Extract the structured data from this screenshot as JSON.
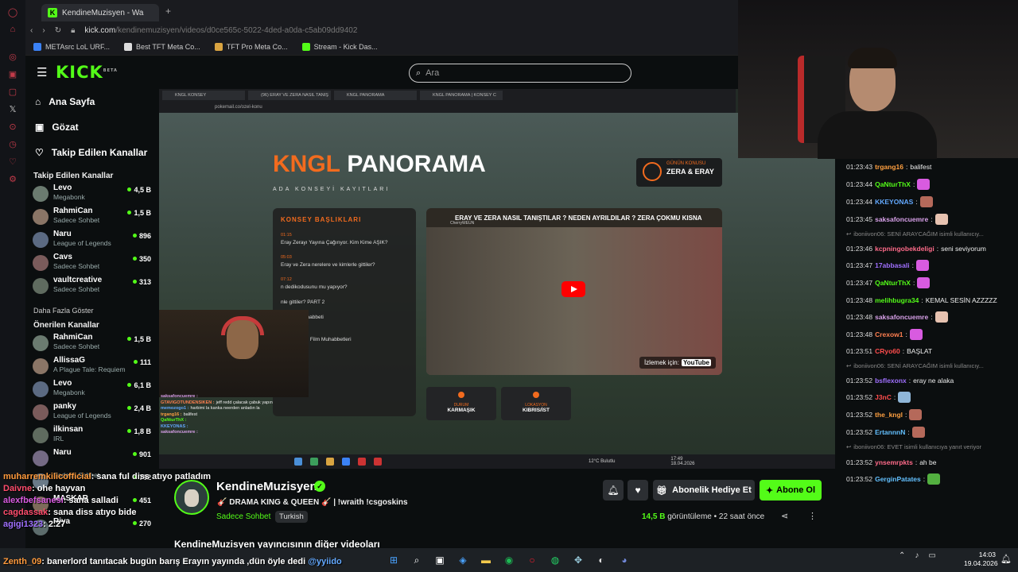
{
  "browser": {
    "tab_title": "KendineMuzisyen - Wa",
    "url_domain": "kick.com",
    "url_path": "/kendinemuzisyen/videos/d0ce565c-5022-4ded-a0da-c5ab09dd9402",
    "bookmarks": [
      "METAsrc LoL URF...",
      "Best TFT Meta Co...",
      "TFT Pro Meta Co...",
      "Stream - Kick Das..."
    ]
  },
  "header": {
    "logo": "KICK",
    "logo_sup": "BETA",
    "search_placeholder": "Ara"
  },
  "nav": {
    "home": "Ana Sayfa",
    "browse": "Gözat",
    "following": "Takip Edilen Kanallar"
  },
  "followed_title": "Takip Edilen Kanallar",
  "followed": [
    {
      "name": "Levo",
      "game": "Megabonk",
      "viewers": "4,5 B"
    },
    {
      "name": "RahmiCan",
      "game": "Sadece Sohbet",
      "viewers": "1,5 B"
    },
    {
      "name": "Naru",
      "game": "League of Legends",
      "viewers": "896"
    },
    {
      "name": "Cavs",
      "game": "Sadece Sohbet",
      "viewers": "350"
    },
    {
      "name": "vaultcreative",
      "game": "Sadece Sohbet",
      "viewers": "313"
    }
  ],
  "show_more": "Daha Fazla Göster",
  "recommended_title": "Önerilen Kanallar",
  "recommended": [
    {
      "name": "RahmiCan",
      "game": "Sadece Sohbet",
      "viewers": "1,5 B"
    },
    {
      "name": "AllissaG",
      "game": "A Plague Tale: Requiem",
      "viewers": "111"
    },
    {
      "name": "Levo",
      "game": "Megabonk",
      "viewers": "6,1 B"
    },
    {
      "name": "panky",
      "game": "League of Legends",
      "viewers": "2,4 B"
    },
    {
      "name": "ilkinsan",
      "game": "IRL",
      "viewers": "1,8 B"
    },
    {
      "name": "Naru",
      "game": "",
      "viewers": "901"
    },
    {
      "name": "",
      "game": "Sadece Sohbet",
      "viewers": "792"
    },
    {
      "name": "MASKAR",
      "game": "",
      "viewers": "451"
    },
    {
      "name": "Riya",
      "game": "",
      "viewers": "270"
    }
  ],
  "video": {
    "inner_tabs": [
      "KNGL KONSEY",
      "(96) ERAY VE ZERA NASIL TANIŞ",
      "KNGL PANORAMA",
      "KNGL PANORAMA | KONSEY C"
    ],
    "inner_url": "pokemail.co/ozel-konu",
    "title_a": "KNGL",
    "title_b": " PANORAMA",
    "subtitle": "ADA KONSEYİ KAYITLARI",
    "gunun_label": "GÜNÜN KONUSU",
    "gunun_value": "ZERA & ERAY",
    "panel_title": "KONSEY BAŞLIKLARI",
    "topics": [
      {
        "n": "01:15",
        "t": "Eray Zerayı Yayına Çağırıyor. Kim Kime AŞIK?"
      },
      {
        "n": "05:03",
        "t": "Eray ve Zera nerelere ve kimlerle gittiler?"
      },
      {
        "n": "07:12",
        "t": "n dedikodusunu mu yapıyor?"
      },
      {
        "n": "",
        "t": "nle gittiler? PART 2"
      },
      {
        "n": "",
        "t": "y Piano Muhabbeti"
      },
      {
        "n": "12:21",
        "t": "Eski ve Yeni Film Muhabbetleri"
      }
    ],
    "yt_title": "ERAY VE ZERA NASIL TANIŞTILAR ? NEDEN AYRILDILAR ? ZERA ÇOKMU KISNA",
    "yt_channel": "CherryWEUN",
    "yt_watch": "İzlemek için:",
    "yt_logo": "YouTube",
    "cat1_label": "KARMAŞIK",
    "cat1_small": "DURUM",
    "cat2_label": "KIBRIS/İST",
    "cat2_small": "LOKASYON",
    "weather": "12°C Bulutlu",
    "time_small": "17:49",
    "date_small": "18.04.2026"
  },
  "inner_chat": [
    {
      "u": "saksafoncuemre :",
      "t": "",
      "c": "#d7a0e8"
    },
    {
      "u": "GTAVIGOTUNDENSIKEN :",
      "t": "jeff redd çalacak çabuk yapın",
      "c": "#ff7f50"
    },
    {
      "u": "memozogo1 :",
      "t": "harbimi la kanka neerden anladın la",
      "c": "#63a9ff"
    },
    {
      "u": "trgang16 :",
      "t": "balifest",
      "c": "#ffa040"
    },
    {
      "u": "QaNturThX :",
      "t": "",
      "c": "#53fc18"
    },
    {
      "u": "KKEYONAS :",
      "t": "",
      "c": "#63a9ff"
    },
    {
      "u": "saksafoncuemre :",
      "t": "",
      "c": "#d7a0e8"
    }
  ],
  "chat": [
    {
      "ts": "01:23:43",
      "u": "trgang16",
      "t": "balifest",
      "c": "#ffa040",
      "e": ""
    },
    {
      "ts": "01:23:44",
      "u": "QaNturThX",
      "t": "",
      "c": "#53fc18",
      "e": "#d85be0"
    },
    {
      "ts": "01:23:44",
      "u": "KKEYONAS",
      "t": "",
      "c": "#63a9ff",
      "e": "#b5695a"
    },
    {
      "ts": "01:23:45",
      "u": "saksafoncuemre",
      "t": "",
      "c": "#d7a0e8",
      "e": "#e7c2b0"
    },
    {
      "reply": "iboniivon06: SENİ ARAYCAĞIM isimli kullanıcıy..."
    },
    {
      "ts": "01:23:46",
      "u": "kcpningobekdeligi",
      "t": "seni seviyorum",
      "c": "#ff6b8a",
      "e": ""
    },
    {
      "ts": "01:23:47",
      "u": "17abbasali",
      "t": "",
      "c": "#a070ff",
      "e": "#d85be0"
    },
    {
      "ts": "01:23:47",
      "u": "QaNturThX",
      "t": "",
      "c": "#53fc18",
      "e": "#d85be0"
    },
    {
      "ts": "01:23:48",
      "u": "melihbugra34",
      "t": "KEMAL SESİN AZZZZZ",
      "c": "#53fc18",
      "e": ""
    },
    {
      "ts": "01:23:48",
      "u": "saksafoncuemre",
      "t": "",
      "c": "#d7a0e8",
      "e": "#e7c2b0"
    },
    {
      "ts": "01:23:48",
      "u": "Crexow1",
      "t": "",
      "c": "#ff7f50",
      "e": "#d85be0"
    },
    {
      "ts": "01:23:51",
      "u": "CRyo60",
      "t": "BAŞLAT",
      "c": "#ff4d4d",
      "e": ""
    },
    {
      "reply": "iboniivon06: SENİ ARAYCAĞIM isimli kullanıcıy..."
    },
    {
      "ts": "01:23:52",
      "u": "bsflexonx",
      "t": "eray ne alaka",
      "c": "#a070ff",
      "e": ""
    },
    {
      "ts": "01:23:52",
      "u": "J3nC",
      "t": "",
      "c": "#ff4d4d",
      "e": "#8fb6d8"
    },
    {
      "ts": "01:23:52",
      "u": "the_kngl",
      "t": "",
      "c": "#ffa040",
      "e": "#b5695a"
    },
    {
      "ts": "01:23:52",
      "u": "ErtannnN",
      "t": "",
      "c": "#63c0ff",
      "e": "#b5695a"
    },
    {
      "reply": "iboniivon06: EVET isimli kullanıcıya yanıt veriyor"
    },
    {
      "ts": "01:23:52",
      "u": "ynsemrpkts",
      "t": "ah be",
      "c": "#ff6b8a",
      "e": ""
    },
    {
      "ts": "01:23:52",
      "u": "GerginPatates",
      "t": "",
      "c": "#63c0ff",
      "e": "#53b040"
    }
  ],
  "channel": {
    "name": "KendineMuzisyen",
    "stream_title": "DRAMA KING & QUEEN",
    "commands": "!wraith !csgoskins",
    "category": "Sadece Sohbet",
    "language": "Turkish",
    "gift_label": "Abonelik Hediye Et",
    "sub_label": "Abone Ol",
    "views_value": "14,5 B",
    "views_label": " görüntüleme",
    "time_ago": "22 saat önce",
    "other_videos": "KendineMuzisyen yayıncısının diğer videoları"
  },
  "overlay_chat": [
    {
      "u": "muharremkilicofficial",
      "t": ": sana ful diss atıyo patladım",
      "c": "#ff9a3c"
    },
    {
      "u": "Daivne",
      "t": ": ohe hayvan",
      "c": "#ff4d6d"
    },
    {
      "u": "alexfbefsanesi",
      "t": ": sana salladi",
      "c": "#d85be0"
    },
    {
      "u": "cagdassak",
      "t": ": sana diss atıyo bide",
      "c": "#ff4d6d"
    },
    {
      "u": "agigi1323",
      "t": ": 2.27",
      "c": "#a070ff"
    }
  ],
  "overlay_bottom": {
    "u": "Zenth_09",
    "t": ": banerlord tanıtacak bugün barış Erayın yayında ,dün öyle dedi ",
    "mention": "@yyiido",
    "c": "#ff9a3c"
  },
  "taskbar": {
    "time": "14:03",
    "date": "19.04.2026"
  }
}
